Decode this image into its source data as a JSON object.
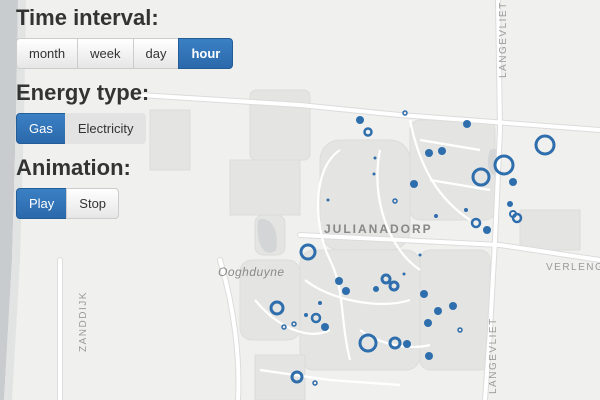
{
  "controls": {
    "time_interval": {
      "heading": "Time interval:",
      "options": [
        "month",
        "week",
        "day",
        "hour"
      ],
      "selected": "hour"
    },
    "energy_type": {
      "heading": "Energy type:",
      "options": [
        "Gas",
        "Electricity"
      ],
      "selected": "Gas"
    },
    "animation": {
      "heading": "Animation:",
      "options": [
        "Play",
        "Stop"
      ],
      "selected": "Play"
    }
  },
  "map": {
    "labels": {
      "district": "JULIANADORP",
      "place": "Ooghduyne",
      "street_langevliet_top": "LANGEVLIET",
      "street_langevliet_bottom": "LANGEVLIET",
      "street_verlengde": "VERLENGDE",
      "street_zanddijk": "ZANDDIJK"
    },
    "colors": {
      "land": "#f0f0ee",
      "sea": "#c9cccf",
      "road": "#ffffff",
      "road_edge": "#dcdcdc",
      "block": "#e4e4e2",
      "marker": "#2f6ead",
      "button_active": "#2f6ead"
    }
  }
}
